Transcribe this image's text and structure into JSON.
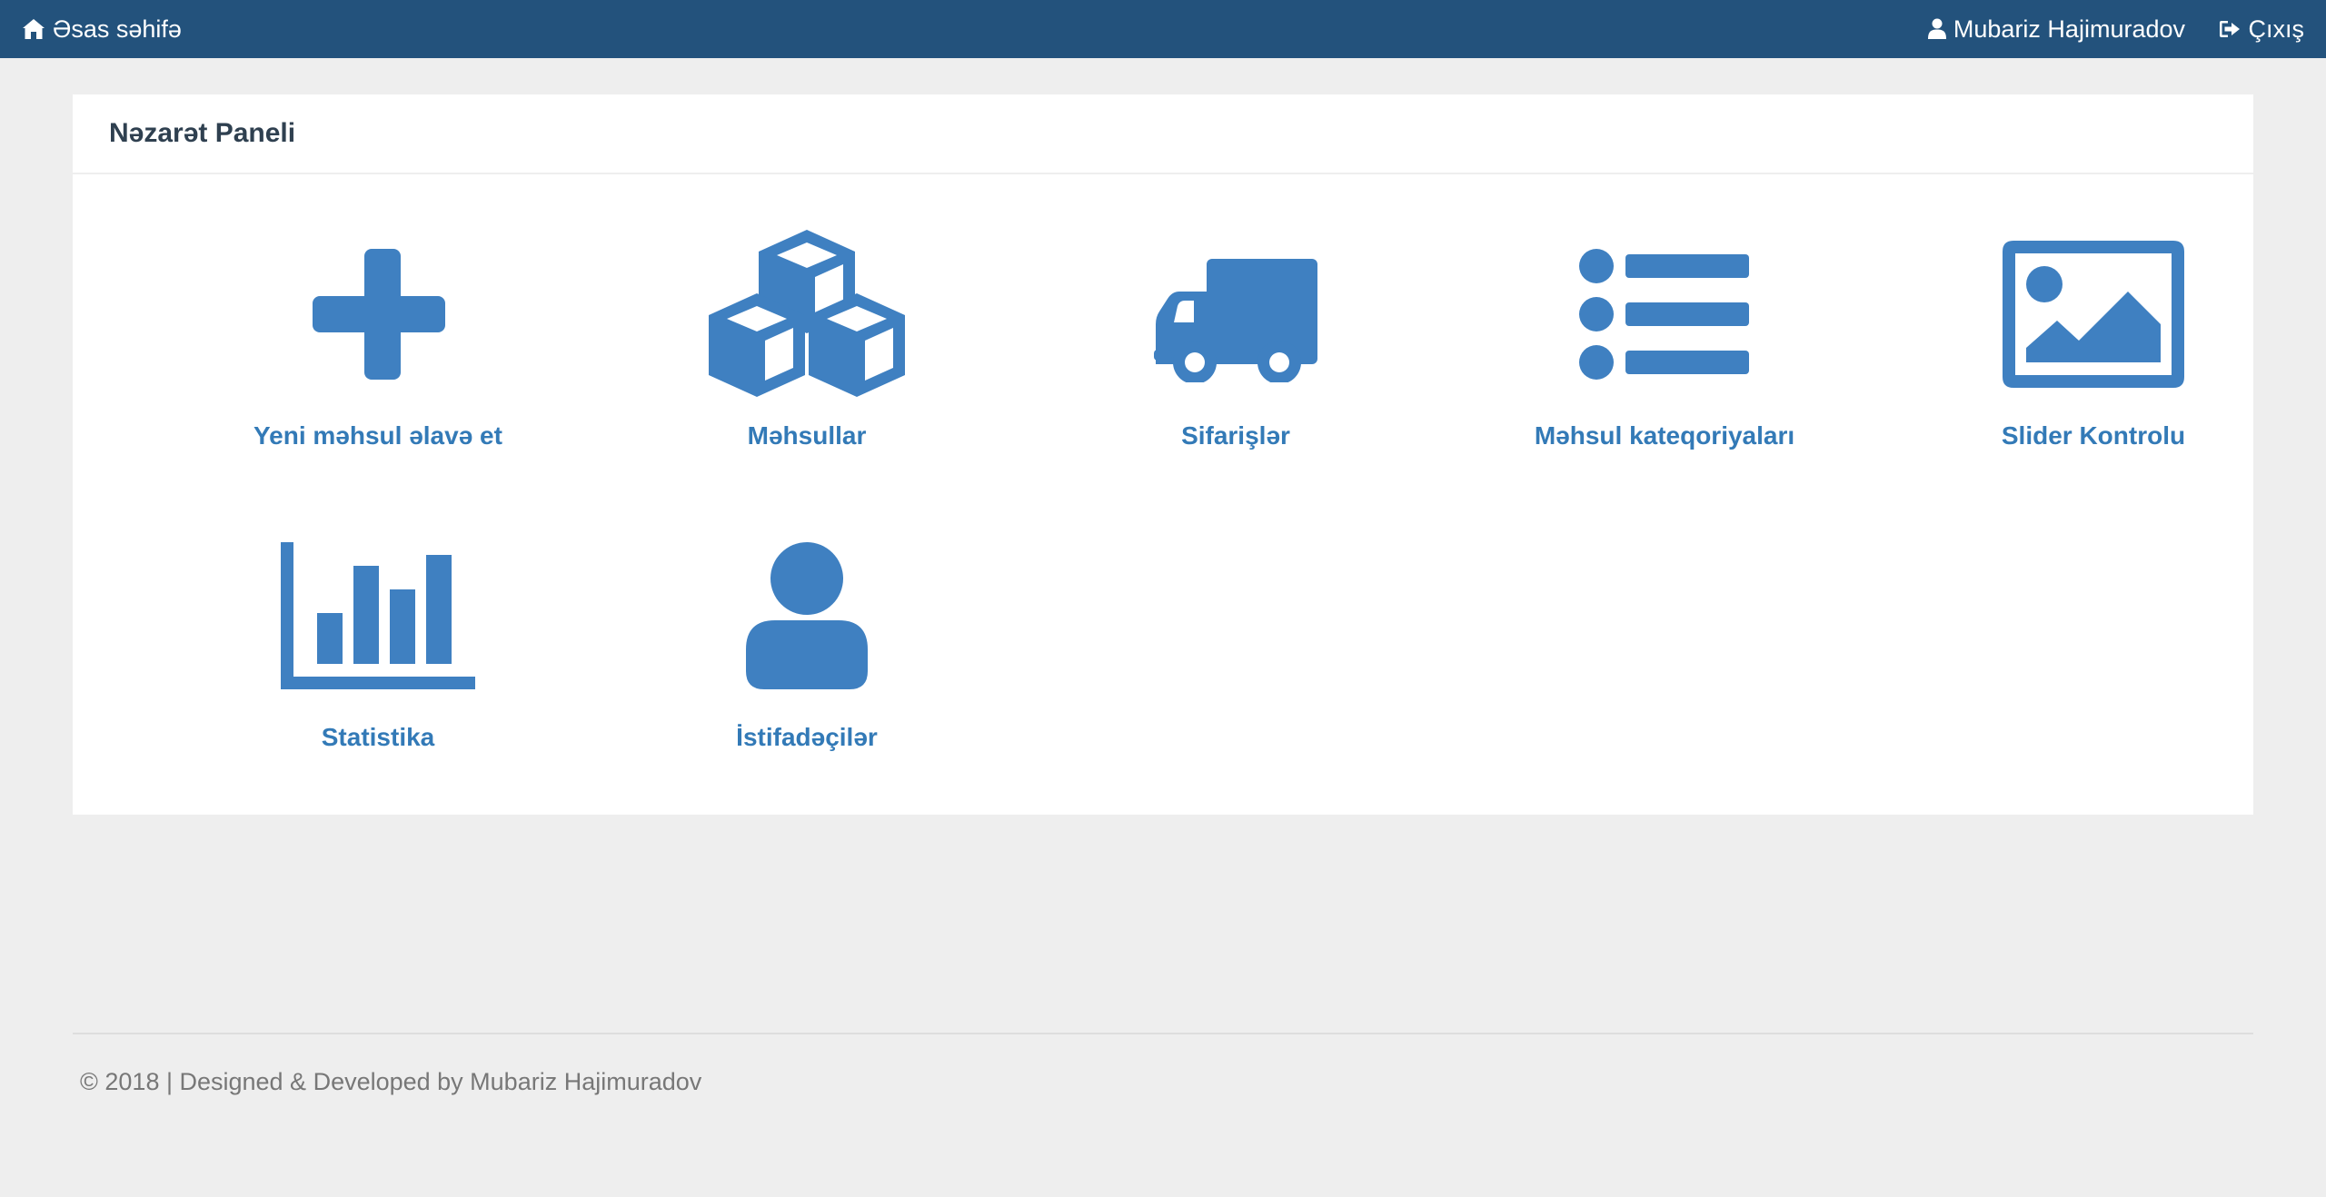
{
  "navbar": {
    "home_label": "Əsas səhifə",
    "user_label": "Mubariz Hajimuradov",
    "logout_label": "Çıxış",
    "background": "#23527c"
  },
  "panel": {
    "title": "Nəzarət Paneli",
    "tiles": [
      {
        "label": "Yeni məhsul əlavə et",
        "icon": "plus-icon"
      },
      {
        "label": "Məhsullar",
        "icon": "cubes-icon"
      },
      {
        "label": "Sifarişlər",
        "icon": "truck-icon"
      },
      {
        "label": "Məhsul kateqoriyaları",
        "icon": "list-icon"
      },
      {
        "label": "Slider Kontrolu",
        "icon": "image-icon"
      },
      {
        "label": "Statistika",
        "icon": "bar-chart-icon"
      },
      {
        "label": "İstifadəçilər",
        "icon": "user-icon"
      }
    ],
    "accent": "#3f80c1",
    "link_color": "#337ab7"
  },
  "footer": {
    "text": "© 2018 | Designed & Developed by Mubariz Hajimuradov"
  }
}
